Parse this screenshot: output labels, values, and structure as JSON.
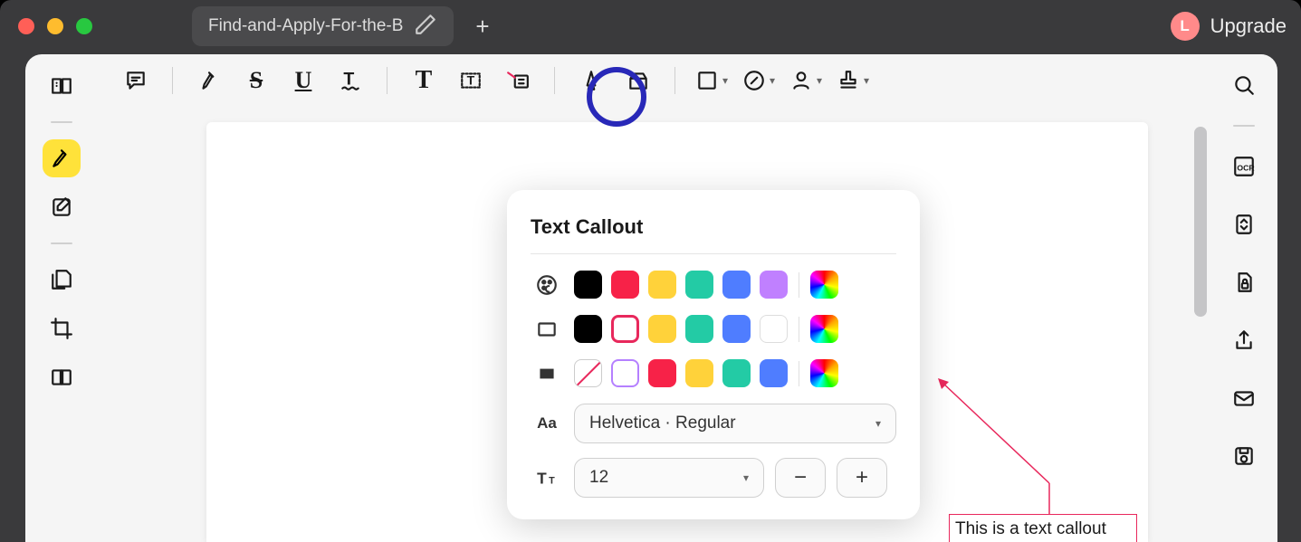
{
  "titlebar": {
    "tab_label": "Find-and-Apply-For-the-B"
  },
  "upgrade": {
    "avatar_letter": "L",
    "label": "Upgrade"
  },
  "popup": {
    "title": "Text Callout",
    "font_label": "Helvetica · Regular",
    "size_value": "12",
    "font_icon_text": "Aa"
  },
  "callout": {
    "text": "This is a text callout"
  },
  "colors": {
    "row1": [
      "#000000",
      "#f72248",
      "#ffd23a",
      "#23cba5",
      "#4f7dff",
      "#c080ff"
    ],
    "row2": [
      "#000000",
      "#e8285c",
      "#ffd23a",
      "#23cba5",
      "#4f7dff",
      "#ffffff"
    ],
    "row3": [
      "#e8285c",
      "#ffd23a",
      "#23cba5",
      "#4f7dff"
    ]
  }
}
